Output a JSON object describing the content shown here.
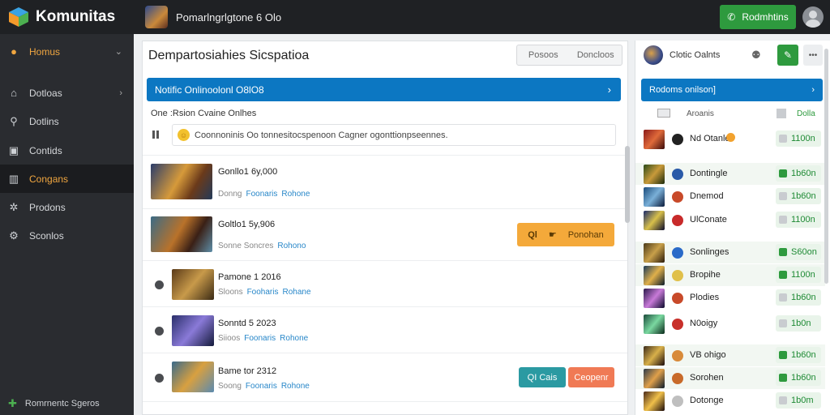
{
  "app": {
    "title": "Komunitas"
  },
  "top": {
    "title": "Pomarlngrlgtone 6 Olo",
    "cta_label": "Rodmhtins"
  },
  "sidebar": {
    "items": [
      {
        "label": "Homus",
        "icon": "home-icon"
      },
      {
        "label": "Dotloas",
        "icon": "house-icon"
      },
      {
        "label": "Dotlins",
        "icon": "search-icon"
      },
      {
        "label": "Contids",
        "icon": "grid-icon"
      },
      {
        "label": "Congans",
        "icon": "gift-icon",
        "active": true
      },
      {
        "label": "Prodons",
        "icon": "settings-icon"
      },
      {
        "label": "Sconlos",
        "icon": "gear-icon"
      }
    ],
    "footer": "Romrnentc Sgeros"
  },
  "main": {
    "title": "Dempartosiahies Sicspatioa",
    "seg_left": "Posoos",
    "seg_right": "Doncloos",
    "banner": "Notific Onlinoolonl O8lO8",
    "sub_label": "One :Rsion Cvaine Onlhes",
    "comment_placeholder": "Coonnoninis Oo tonnesitocspenoon Cagner ogonttionpseennes.",
    "rows": [
      {
        "title": "Gonllo1 6y,000",
        "meta": "Donng",
        "link1": "Foonaris",
        "link2": "Rohone"
      },
      {
        "title": "Goltlo1 5y,906",
        "meta": "Sonne Soncres",
        "link1": "",
        "link2": "Rohono",
        "action_icon": "Ql",
        "action_label": "Ponohan"
      },
      {
        "title": "Pamone 1 2016",
        "meta": "Sloons",
        "link1": "Fooharis",
        "link2": "Rohane"
      },
      {
        "title": "Sonntd 5 2023",
        "meta": "Siioos",
        "link1": "Foonaris",
        "link2": "Rohone"
      },
      {
        "title": "Bame tor 2312",
        "meta": "Soong",
        "link1": "Foonaris",
        "link2": "Rohone",
        "btn_teal": "QI Cais",
        "btn_salmon": "Ceopenr"
      }
    ]
  },
  "right": {
    "user": "Clotic Oalnts",
    "header": "Rodoms onilson]",
    "col1": "Aroanis",
    "col2": "Dolla",
    "rows": [
      {
        "name": "Nd Otanle",
        "value": "1100n",
        "checked": false,
        "alt": false,
        "badge": true
      },
      {
        "name": "Dontingle",
        "value": "1b60n",
        "checked": true,
        "alt": true
      },
      {
        "name": "Dnemod",
        "value": "1b60n",
        "checked": false,
        "alt": false
      },
      {
        "name": "UlConate",
        "value": "1100n",
        "checked": false,
        "alt": false
      },
      {
        "name": "Sonlinges",
        "value": "S60on",
        "checked": true,
        "alt": true
      },
      {
        "name": "Bropihe",
        "value": "1100n",
        "checked": true,
        "alt": true
      },
      {
        "name": "Plodies",
        "value": "1b60n",
        "checked": false,
        "alt": false
      },
      {
        "name": "N0oigy",
        "value": "1b0n",
        "checked": false,
        "alt": false
      },
      {
        "name": "VB ohigo",
        "value": "1b60n",
        "checked": true,
        "alt": true
      },
      {
        "name": "Sorohen",
        "value": "1b60n",
        "checked": true,
        "alt": true
      },
      {
        "name": "Dotonge",
        "value": "1b0m",
        "checked": false,
        "alt": false
      }
    ]
  },
  "colors": {
    "accent_blue": "#0c77c2",
    "green": "#2e9a3e",
    "orange": "#f4a93a",
    "sidebar": "#2a2c30",
    "topbar": "#1f2124"
  }
}
